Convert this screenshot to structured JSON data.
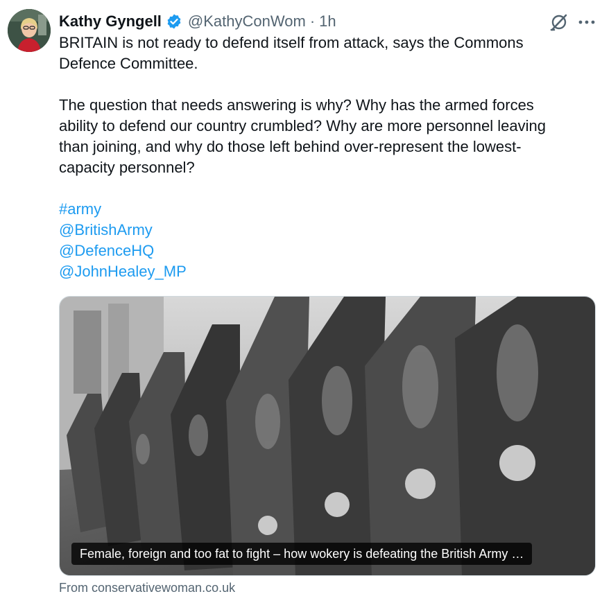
{
  "author": {
    "display_name": "Kathy Gyngell",
    "handle": "@KathyConWom",
    "separator": "·",
    "time": "1h"
  },
  "tweet": {
    "para1_line1": "BRITAIN is not ready to defend itself from attack, says the Commons",
    "para1_line2": "Defence Committee.",
    "para2_line1": "The question that needs answering is why? Why has the armed forces",
    "para2_line2": "ability to defend our country crumbled? Why are more personnel leaving",
    "para2_line3": "than joining, and why do those left behind over-represent the lowest-",
    "para2_line4": "capacity personnel?",
    "hashtag": "#army",
    "mentions": [
      "@BritishArmy",
      "@DefenceHQ",
      "@JohnHealey_MP"
    ]
  },
  "card": {
    "title": "Female, foreign and too fat to fight – how wokery is defeating the British Army …",
    "source": "From conservativewoman.co.uk"
  },
  "icons": {
    "verified": "verified-badge-icon",
    "grok": "grok-icon",
    "more": "more-options-icon"
  },
  "colors": {
    "link": "#1d9bf0",
    "verified": "#1d9bf0",
    "muted": "#536471"
  }
}
